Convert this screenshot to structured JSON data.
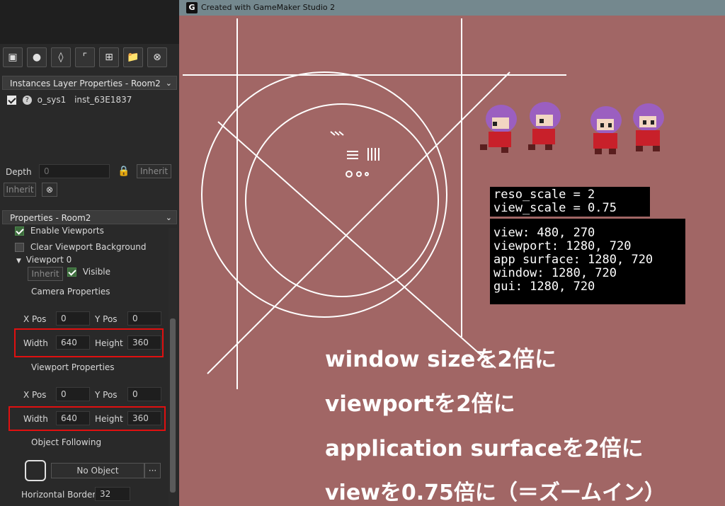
{
  "window": {
    "title": "Created with GameMaker Studio 2"
  },
  "toolbar": {
    "icons": [
      "image-icon",
      "circles-icon",
      "layers-icon",
      "path-icon",
      "add-layer-icon",
      "folder-icon",
      "close-circle-icon"
    ]
  },
  "instances_panel": {
    "header": "Instances Layer Properties - Room2",
    "item_object": "o_sys1",
    "item_instance": "inst_63E1837",
    "depth_label": "Depth",
    "depth_value": "0",
    "inherit_label": "Inherit"
  },
  "properties_panel": {
    "header": "Properties - Room2",
    "enable_viewports": "Enable Viewports",
    "clear_viewport_bg": "Clear Viewport Background",
    "viewport0": "Viewport 0",
    "inherit_label": "Inherit",
    "visible_label": "Visible",
    "camera_properties": "Camera Properties",
    "viewport_properties": "Viewport Properties",
    "xpos_label": "X Pos",
    "ypos_label": "Y Pos",
    "width_label": "Width",
    "height_label": "Height",
    "camera": {
      "x": "0",
      "y": "0",
      "width": "640",
      "height": "360"
    },
    "viewport": {
      "x": "0",
      "y": "0",
      "width": "640",
      "height": "360"
    },
    "object_following": "Object Following",
    "no_object": "No Object",
    "more": "···",
    "horizontal_border_label": "Horizontal Border",
    "horizontal_border_value": "32"
  },
  "debug": {
    "line1": "reso_scale = 2",
    "line2": "view_scale = 0.75",
    "line3": "view: 480, 270",
    "line4": "viewport: 1280, 720",
    "line5": "app surface: 1280, 720",
    "line6": "window: 1280, 720",
    "line7": "gui: 1280, 720"
  },
  "captions": {
    "c1": "window sizeを2倍に",
    "c2": "viewportを2倍に",
    "c3": "application surfaceを2倍に",
    "c4": "viewを0.75倍に（＝ズームイン）"
  },
  "colors": {
    "game_bg": "#a16665",
    "highlight_box": "#e01010",
    "titlebar": "#74888e"
  }
}
